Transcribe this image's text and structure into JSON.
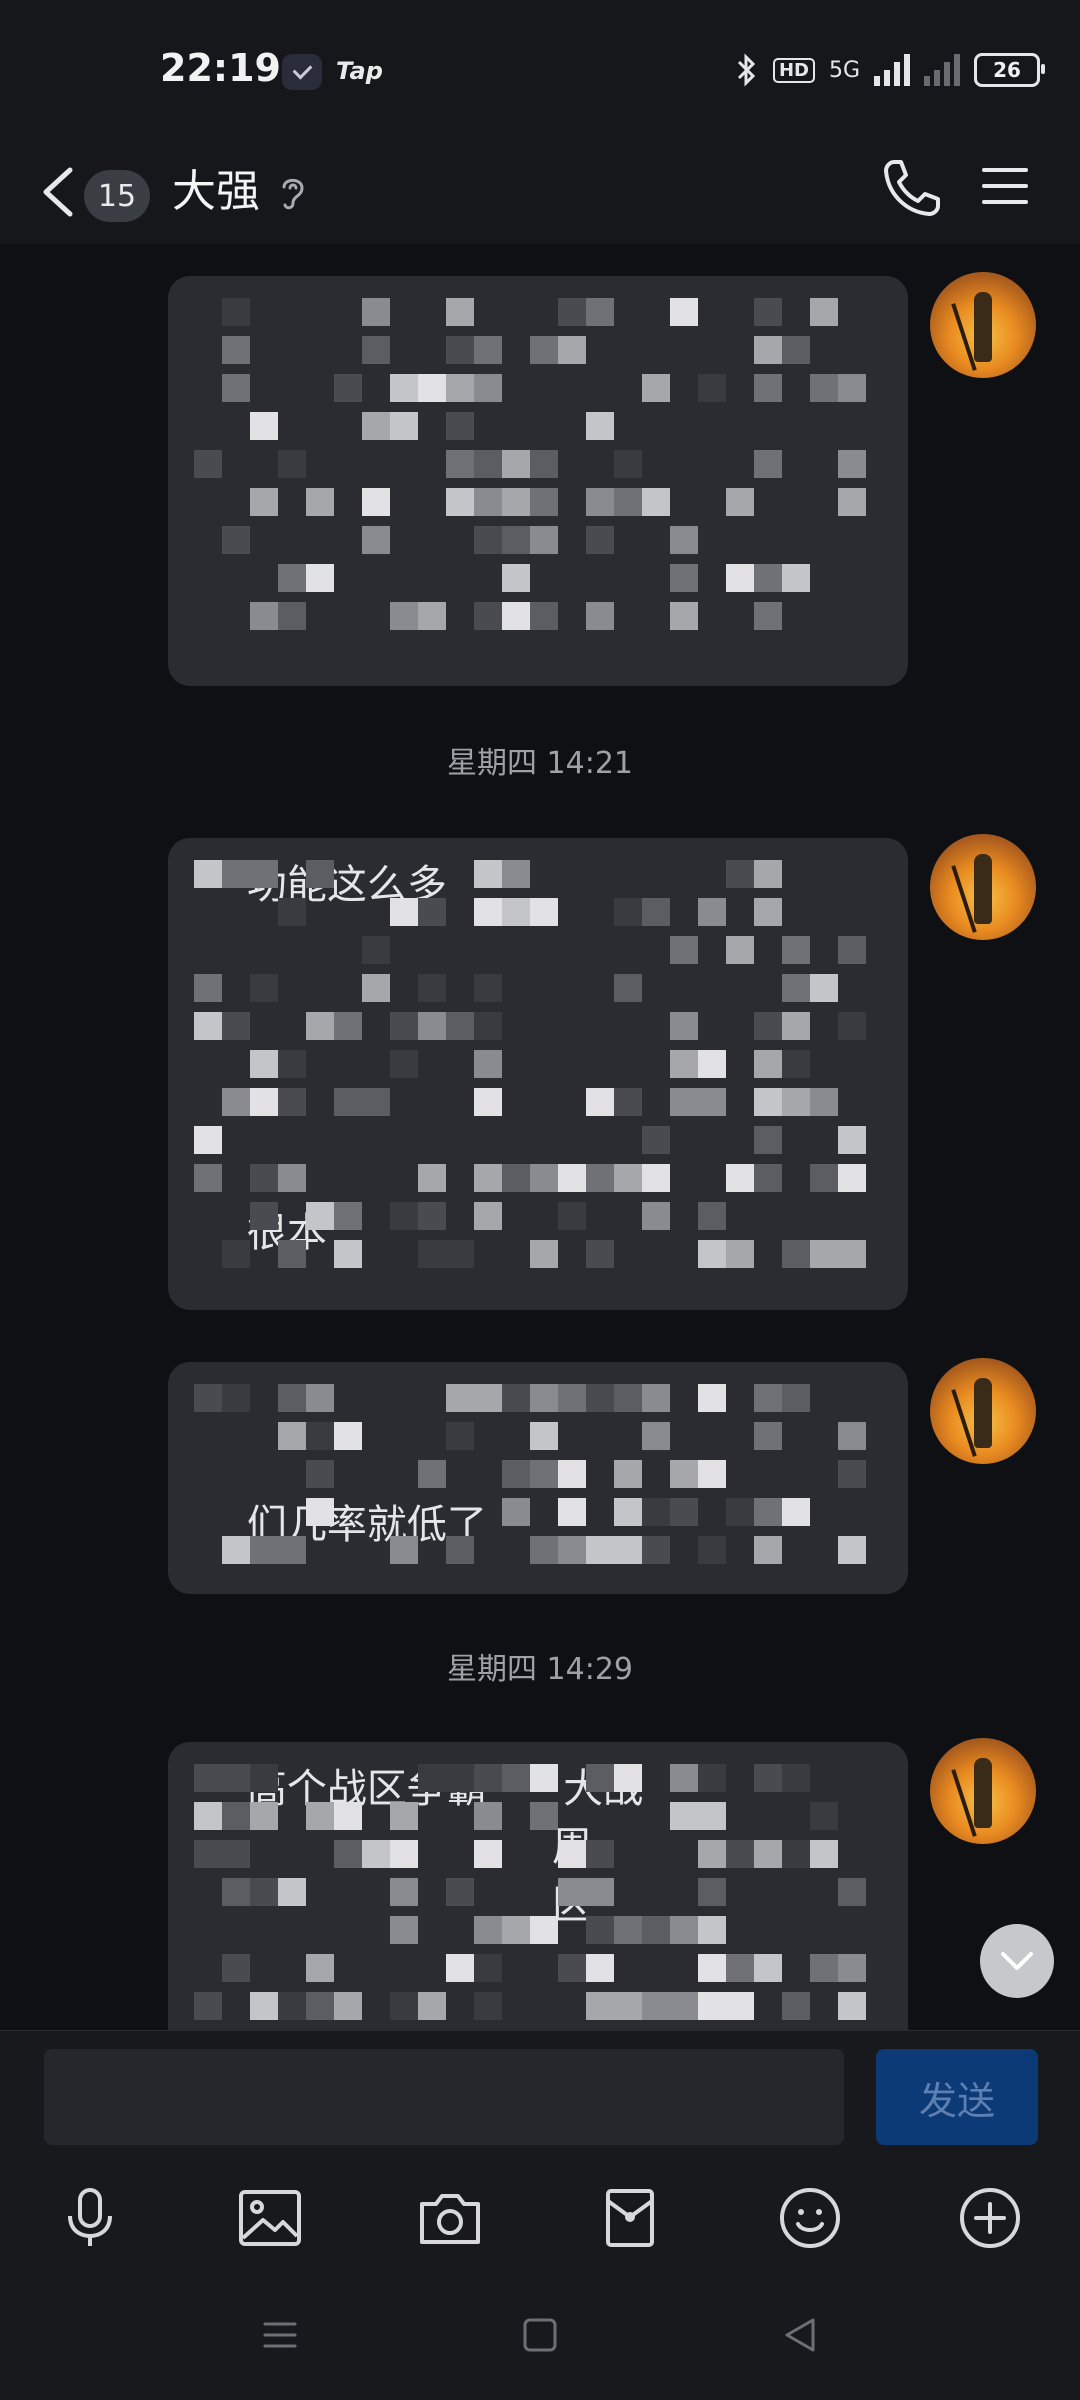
{
  "status_bar": {
    "time": "22:19",
    "app_label": "Tap",
    "hd_label": "HD",
    "network_label": "5G",
    "battery": "26"
  },
  "header": {
    "unread_count": "15",
    "contact_name": "大强"
  },
  "messages": [
    {
      "text": "\n\n\n\n\n\n"
    },
    {
      "text": "    功能这么多\n\n\n\n\n\n    很本"
    },
    {
      "text": "\n\n    们几率就低了"
    },
    {
      "text": "    高个战区争霸      大战\n                            周\n                            区"
    }
  ],
  "timestamps": {
    "t1": "星期四 14:21",
    "t2": "星期四 14:29"
  },
  "composer": {
    "placeholder": "",
    "send_label": "发送"
  },
  "icons": {
    "back": "chevron-left-icon",
    "hearing": "ear-icon",
    "call": "phone-icon",
    "menu": "menu-icon",
    "scroll": "chevron-down-icon",
    "voice": "microphone-icon",
    "image": "image-icon",
    "camera": "camera-icon",
    "redpacket": "red-packet-icon",
    "emoji": "emoji-icon",
    "more": "plus-circle-icon"
  },
  "colors": {
    "background": "#0f1014",
    "bubble": "#2b2c31",
    "send_button": "#0b3a77"
  }
}
